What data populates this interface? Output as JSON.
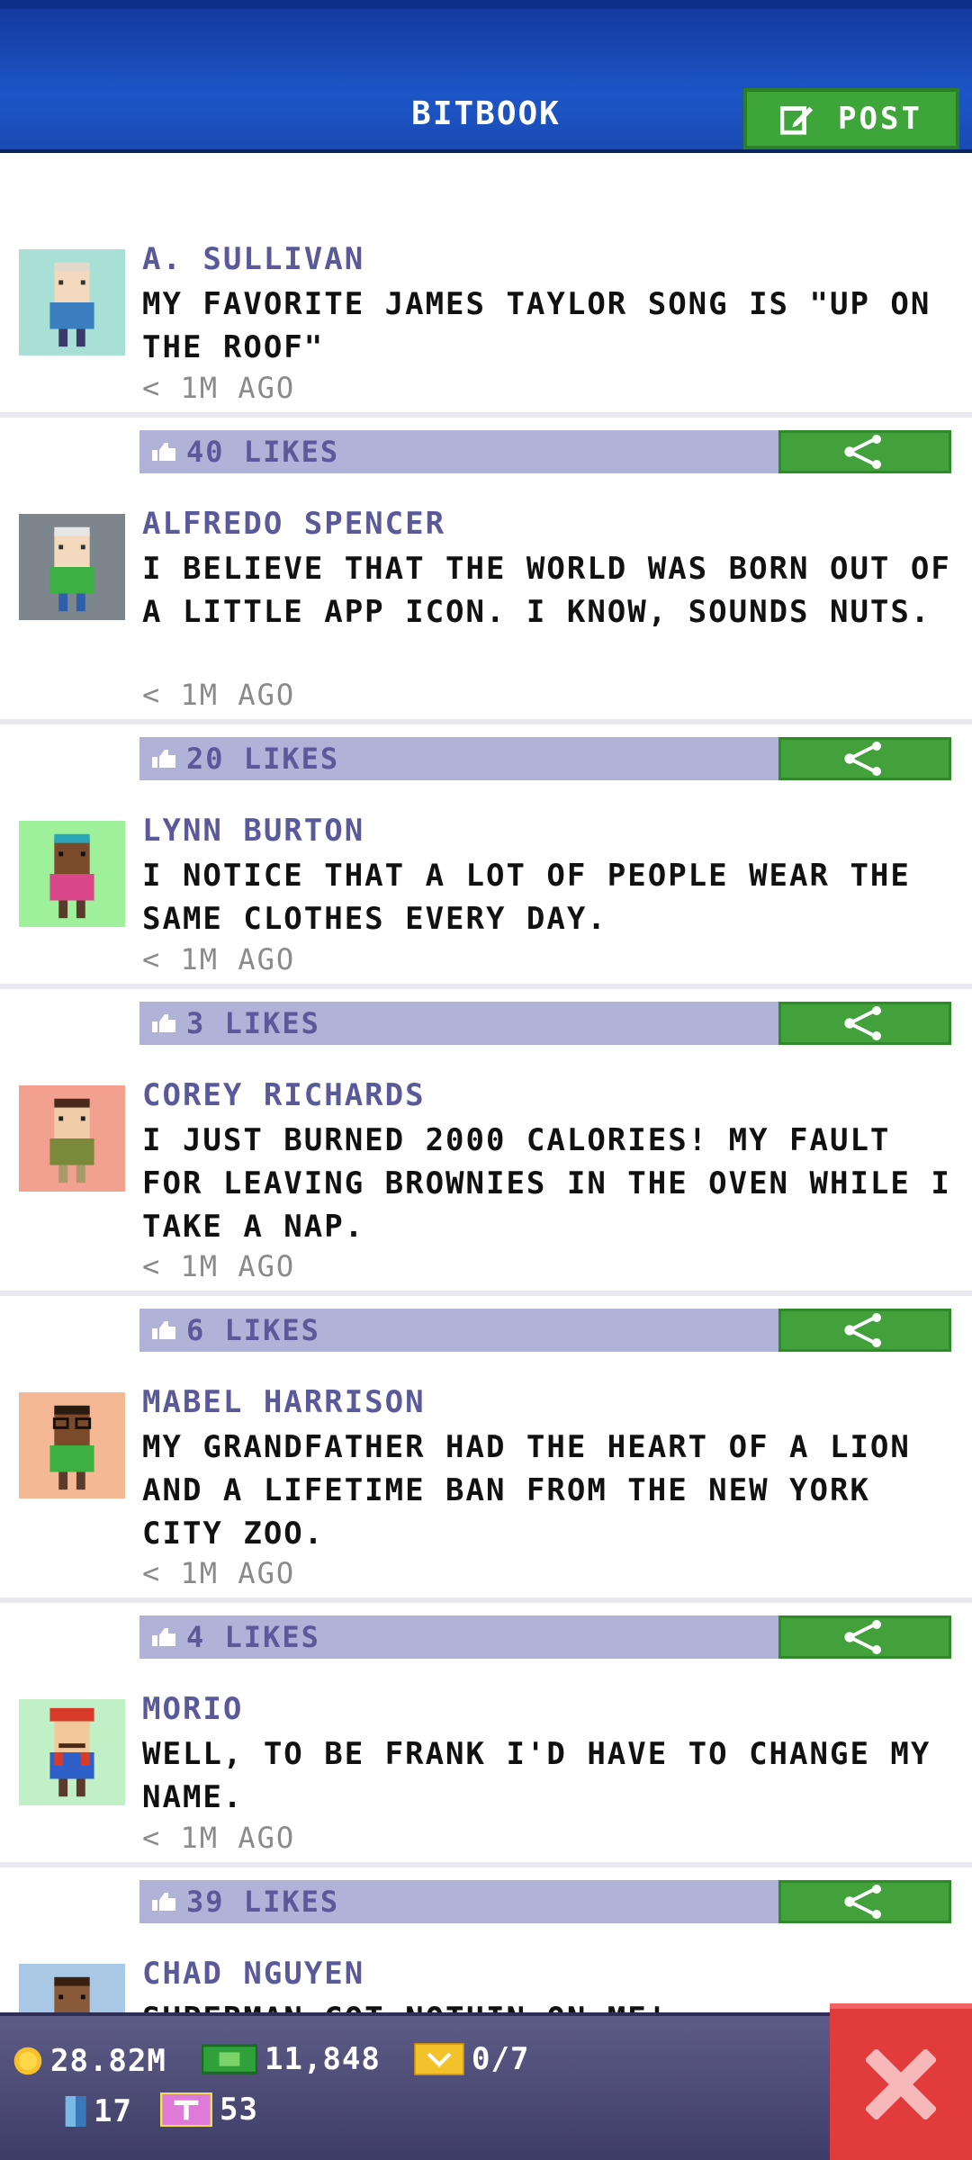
{
  "header": {
    "title": "BITBOOK",
    "post_label": "POST"
  },
  "posts": [
    {
      "author": "A. SULLIVAN",
      "text": "MY FAVORITE JAMES TAYLOR SONG IS \"UP ON THE ROOF\"",
      "time": "< 1M AGO",
      "likes": "40 LIKES",
      "avatar_bg": "#a8e0d6"
    },
    {
      "author": "ALFREDO SPENCER",
      "text": "I BELIEVE THAT THE WORLD WAS BORN OUT OF A LITTLE APP ICON. I KNOW, SOUNDS NUTS.",
      "time": "< 1M AGO",
      "likes": "20 LIKES",
      "avatar_bg": "#7d868d"
    },
    {
      "author": "LYNN BURTON",
      "text": "I NOTICE THAT A LOT OF PEOPLE WEAR THE SAME CLOTHES EVERY DAY.",
      "time": "< 1M AGO",
      "likes": "3 LIKES",
      "avatar_bg": "#9ef09a"
    },
    {
      "author": "COREY RICHARDS",
      "text": "I JUST BURNED 2000 CALORIES! MY FAULT FOR LEAVING BROWNIES IN THE OVEN WHILE I TAKE A NAP.",
      "time": "< 1M AGO",
      "likes": "6 LIKES",
      "avatar_bg": "#f2a090"
    },
    {
      "author": "MABEL HARRISON",
      "text": "MY GRANDFATHER HAD THE HEART OF A LION AND A LIFETIME BAN FROM THE NEW YORK CITY ZOO.",
      "time": "< 1M AGO",
      "likes": "4 LIKES",
      "avatar_bg": "#f5b894"
    },
    {
      "author": "MORIO",
      "text": "WELL, TO BE FRANK I'D HAVE TO CHANGE MY NAME.",
      "time": "< 1M AGO",
      "likes": "39 LIKES",
      "avatar_bg": "#c2f0c6"
    },
    {
      "author": "CHAD NGUYEN",
      "text": "SUPERMAN GOT NOTHIN ON ME!",
      "time": "",
      "likes": "",
      "avatar_bg": "#a8c8e6"
    }
  ],
  "stats": {
    "coins": "28.82M",
    "bux": "11,848",
    "tickets": "0/7",
    "elevator": "17",
    "tv": "53"
  },
  "colors": {
    "header": "#1d55c7",
    "post_button": "#3ea53a",
    "likes_bar": "#b0b2d8",
    "share": "#43a13c",
    "close": "#e23b3b"
  }
}
